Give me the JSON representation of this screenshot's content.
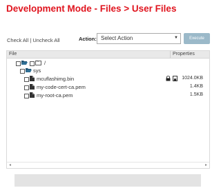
{
  "page": {
    "title": "Development Mode - Files > User Files"
  },
  "toolbar": {
    "check_all": "Check All",
    "separator": " | ",
    "uncheck_all": "Uncheck All",
    "action_label": "Action:",
    "action_value": "Select Action",
    "execute_label": "Execute"
  },
  "table": {
    "col_file": "File",
    "col_properties": "Properties"
  },
  "tree": {
    "root": {
      "name": "/",
      "icon": "folder-open-icon"
    },
    "folder": {
      "name": "sys",
      "icon": "folder-open-icon"
    },
    "files": [
      {
        "name": "mcuflashimg.bin",
        "size": "1024.0KB",
        "locked": true,
        "icon": "file-icon"
      },
      {
        "name": "my-code-cert-ca.pem",
        "size": "1.4KB",
        "locked": false,
        "icon": "file-icon"
      },
      {
        "name": "my-root-ca.pem",
        "size": "1.5KB",
        "locked": false,
        "icon": "file-icon"
      }
    ]
  },
  "scrollbar": {
    "left_arrow": "◂",
    "right_arrow": "▸"
  },
  "colors": {
    "title": "#e0141e",
    "execute_bg": "#9bb9c9"
  }
}
